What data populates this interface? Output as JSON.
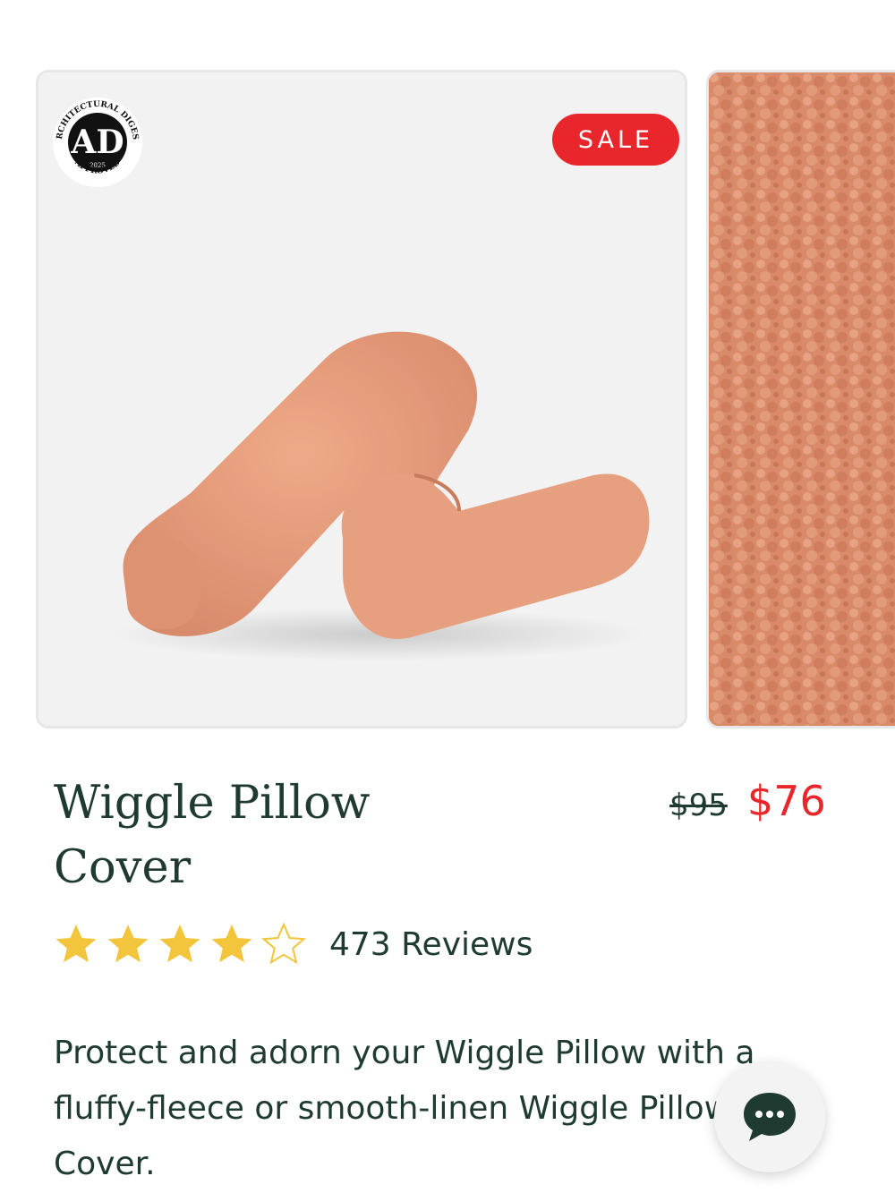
{
  "gallery": {
    "badge_text": "SALE",
    "ad_badge": {
      "icon": "architectural-digest-approved-seal",
      "ring_text_top": "ARCHITECTURAL DIGEST",
      "monogram": "AD",
      "year": "2025",
      "ring_text_bottom": "APPROVED"
    },
    "images": [
      {
        "icon": "wiggle-pillow-product-photo"
      },
      {
        "icon": "fleece-texture-closeup"
      }
    ]
  },
  "product": {
    "title": "Wiggle Pillow Cover",
    "price_original": "$95",
    "price_sale": "$76",
    "rating": 4,
    "rating_max": 5,
    "reviews_label": "473 Reviews",
    "description": "Protect and adorn your Wiggle Pillow with a fluffy-fleece or smooth-linen Wiggle Pillow Cover."
  },
  "chat": {
    "icon": "chat-bubble-icon"
  },
  "colors": {
    "text_primary": "#1e3a31",
    "sale_red": "#e8262b",
    "star_gold": "#f2c53d",
    "pillow": "#e39a7a"
  }
}
